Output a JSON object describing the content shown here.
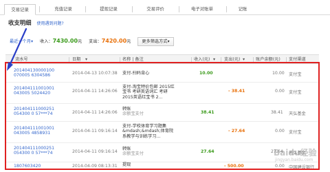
{
  "tabs": [
    {
      "label": "交易记录",
      "active": true
    },
    {
      "label": "充值记录",
      "active": false
    },
    {
      "label": "提现记录",
      "active": false
    },
    {
      "label": "交易评价",
      "active": false
    },
    {
      "label": "电子对账单",
      "active": false
    },
    {
      "label": "记账",
      "active": false
    }
  ],
  "page": {
    "title": "收支明细",
    "help_link": "使用遇到问题?"
  },
  "filter": {
    "range": "最近一个月",
    "range_arrow": "▾",
    "income_label": "收入：",
    "income_value": "7430.00",
    "income_unit": "元",
    "expense_label": "支出：",
    "expense_value": "7420.00",
    "expense_unit": "元",
    "more_button": "更多筛选方式",
    "more_button_arrow": "▾"
  },
  "table": {
    "headers": {
      "serial": "流水号",
      "date": "日期",
      "name": "名称 | 备注",
      "income": "收入(元)",
      "expense": "支出(元)",
      "balance": "账户余额(元)",
      "channel": "支付渠道"
    },
    "rows": [
      {
        "serial": "201404130000100070005 6304586",
        "date": "2014-04-13 10:07:38",
        "desc": "支付-扫码背心",
        "note": "",
        "income": "10.00",
        "expense": "",
        "balance": "10.00",
        "channel": "支付宝"
      },
      {
        "serial": "201404111001001043005 5024420",
        "date": "2014-04-11 14:26:06",
        "desc": "支付-淘宝特价包邮 2015红宝书",
        "note": "考研英语词汇 考研2015英语红宝书 2...",
        "income": "",
        "expense": "- 38.41",
        "balance": "0.00",
        "channel": "支付宝"
      },
      {
        "serial": "201404111000251054300 0 57***74",
        "date": "2014-04-11 14:26:06",
        "desc": "转账",
        "note": "余额宝支付",
        "income": "38.41",
        "expense": "",
        "balance": "38.41",
        "channel": "天弘基金"
      },
      {
        "serial": "201404111001001043005 4858931",
        "date": "2014-04-11 09:16:14",
        "desc": "支付-学校体育学习题集",
        "note": "&mdash;&mdash;体育院系教学与训练学习...",
        "income": "",
        "expense": "- 27.64",
        "balance": "0.00",
        "channel": "支付宝"
      },
      {
        "serial": "201404111000251054300 0 57***74",
        "date": "2014-04-11 09:16:14",
        "desc": "转账",
        "note": "余额宝支付",
        "income": "27.64",
        "expense": "",
        "balance": "27.64",
        "channel": "天弘基金"
      },
      {
        "serial": "1807603420",
        "date": "2014-04-09 08:13:31",
        "desc": "提现",
        "note": "",
        "income": "",
        "expense": "- 500.00",
        "balance": "0.00",
        "channel": "中国建设银行"
      }
    ]
  },
  "watermark": {
    "text": "Baidu经验",
    "sub": "jingyan.baidu.com"
  },
  "colors": {
    "link": "#3366cc",
    "income": "#3a9a1a",
    "expense": "#e8700a",
    "highlight": "#e02020",
    "arrow": "#2a3fc8"
  }
}
